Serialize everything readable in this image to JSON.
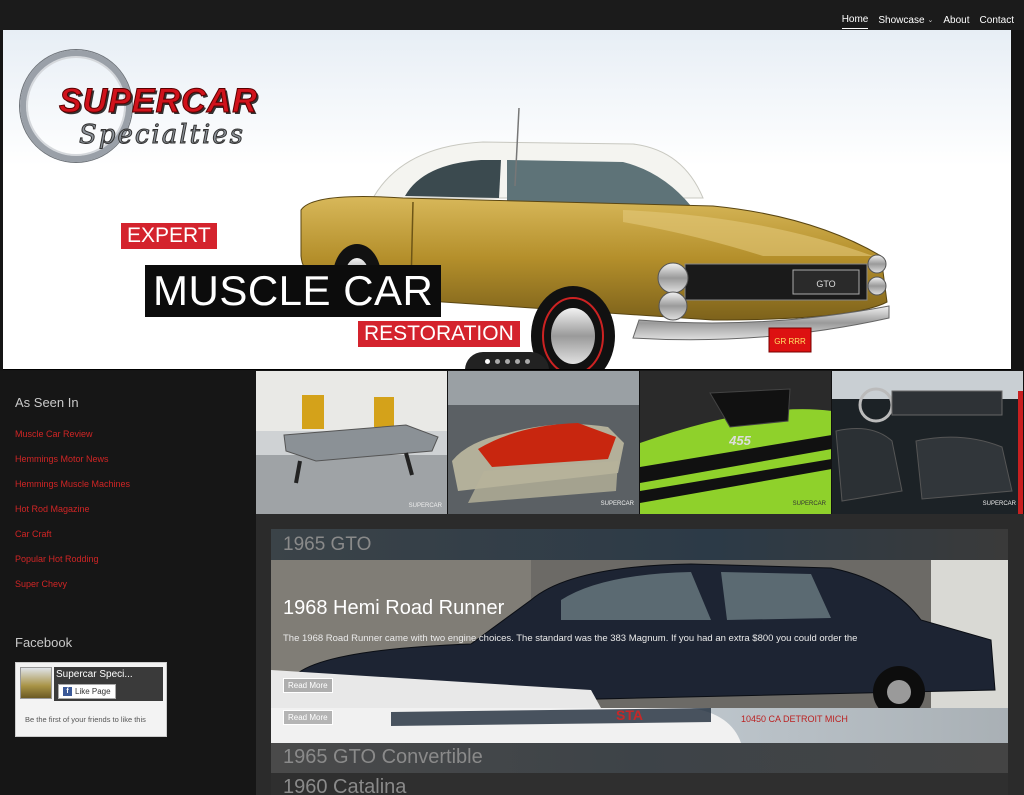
{
  "nav": {
    "items": [
      {
        "label": "Home",
        "active": true
      },
      {
        "label": "Showcase",
        "dropdown": true
      },
      {
        "label": "About"
      },
      {
        "label": "Contact"
      }
    ]
  },
  "hero": {
    "logo_word": "SUPERCAR",
    "logo_script": "Specialties",
    "tag_top": "EXPERT",
    "tag_main": "MUSCLE CAR",
    "tag_bottom": "RESTORATION",
    "car_plate": "GR RRR",
    "grille_badge": "GTO",
    "slides": 5,
    "active_slide": 0
  },
  "sidebar": {
    "seen_heading": "As Seen In",
    "links": [
      "Muscle Car Review",
      "Hemmings Motor News",
      "Hemmings Muscle Machines",
      "Hot Rod Magazine",
      "Car Craft",
      "Popular Hot Rodding",
      "Super Chevy"
    ],
    "facebook_heading": "Facebook",
    "facebook": {
      "page_name": "Supercar Speci...",
      "like_label": "Like Page",
      "friends_text": "Be the first of your friends to like this"
    }
  },
  "gallery": {
    "watermark": "SUPERCAR",
    "badge_455": "455"
  },
  "showcase": {
    "top_card_title": "1965 GTO",
    "main_card": {
      "title": "1968 Hemi Road Runner",
      "description": "The 1968 Road Runner came with two engine choices. The standard was the 383 Magnum. If you had an extra $800 you could order the",
      "button": "Read More"
    },
    "second_button": "Read More",
    "plate_text": "10450 CA DETROIT MICH",
    "side_text": "STA",
    "lower_card_title": "1965 GTO Convertible",
    "bottom_card_title": "1960 Catalina"
  },
  "colors": {
    "accent_red": "#d4232d",
    "link_red": "#d02525",
    "car_gold": "#b8962e",
    "lime": "#9acd32"
  }
}
